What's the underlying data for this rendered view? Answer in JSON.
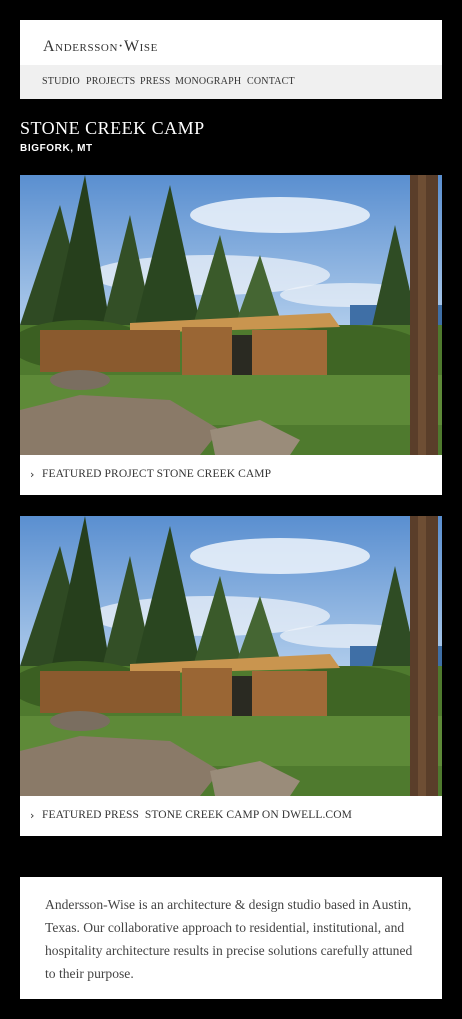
{
  "header": {
    "logo": "Andersson·Wise",
    "nav": [
      "STUDIO",
      "PROJECTS",
      "PRESS",
      "MONOGRAPH",
      "CONTACT"
    ]
  },
  "project": {
    "title": "STONE CREEK CAMP",
    "location": "BIGFORK, MT"
  },
  "cards": [
    {
      "caption": "FEATURED PROJECT STONE CREEK CAMP",
      "image": "stone-creek-camp-photo"
    },
    {
      "caption": "FEATURED PRESS  STONE CREEK CAMP ON DWELL.COM",
      "image": "stone-creek-camp-photo"
    }
  ],
  "about": {
    "text": "Andersson-Wise is an architecture & design studio based in Austin, Texas. Our collaborative approach to residential, institutional, and hospitality architecture results in precise solutions carefully attuned to their purpose."
  },
  "colors": {
    "background": "#000000",
    "panel": "#ffffff",
    "nav_bar": "#f0f0f0",
    "text": "#333333"
  }
}
